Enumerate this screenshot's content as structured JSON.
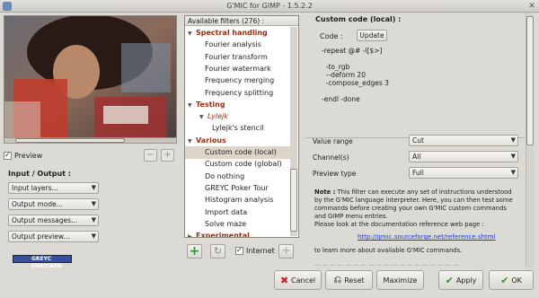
{
  "window": {
    "title": "G'MIC for GIMP - 1.5.2.2",
    "close_glyph": "✕"
  },
  "preview": {
    "checkbox_label": "Preview",
    "checked": true,
    "zoom_out_glyph": "−",
    "zoom_in_glyph": "+"
  },
  "io": {
    "title": "Input / Output :",
    "combos": [
      "Input layers...",
      "Output mode...",
      "Output messages...",
      "Output preview..."
    ]
  },
  "filters": {
    "header": "Available filters (276) :",
    "rows": [
      {
        "label": "Spectral handling",
        "type": "category",
        "expanded": true
      },
      {
        "label": "Fourier analysis",
        "type": "item"
      },
      {
        "label": "Fourier transform",
        "type": "item"
      },
      {
        "label": "Fourier watermark",
        "type": "item"
      },
      {
        "label": "Frequency merging",
        "type": "item"
      },
      {
        "label": "Frequency splitting",
        "type": "item"
      },
      {
        "label": "Testing",
        "type": "category",
        "expanded": true
      },
      {
        "label": "Lylejk",
        "type": "subcategory",
        "expanded": true
      },
      {
        "label": "Lylejk's stencil",
        "type": "subitem"
      },
      {
        "label": "Various",
        "type": "category",
        "expanded": true
      },
      {
        "label": "Custom code (local)",
        "type": "item",
        "selected": true
      },
      {
        "label": "Custom code (global)",
        "type": "item"
      },
      {
        "label": "Do nothing",
        "type": "item"
      },
      {
        "label": "GREYC Poker Tour",
        "type": "item"
      },
      {
        "label": "Histogram analysis",
        "type": "item"
      },
      {
        "label": "Import data",
        "type": "item"
      },
      {
        "label": "Solve maze",
        "type": "item"
      },
      {
        "label": "Experimental",
        "type": "category",
        "expanded": false
      }
    ],
    "internet_label": "Internet",
    "internet_checked": true
  },
  "panel": {
    "filter_title": "Custom code (local) :",
    "code_label": "Code :",
    "update_label": "Update",
    "code_text": "-repeat @# -l[$>]\n\n  -to_rgb\n  --deform 20\n  -compose_edges 3\n\n-endl -done",
    "params": [
      {
        "label": "Value range",
        "value": "Cut"
      },
      {
        "label": "Channel(s)",
        "value": "All"
      },
      {
        "label": "Preview type",
        "value": "Full"
      }
    ],
    "note_bold": "Note :",
    "note_text": " This filter can execute any set of instructions understood by the G'MIC language interpreter. Here, you can then test some commands before creating your own G'MIC custom commands and GIMP menu entries.",
    "doc_text": "Please look at the documentation reference web page :",
    "doc_link": "http://gmic.sourceforge.net/reference.shtml",
    "learn_text": "to learn more about available G'MIC commands."
  },
  "buttons": {
    "cancel": "Cancel",
    "reset": "Reset",
    "maximize": "Maximize",
    "apply": "Apply",
    "ok": "OK"
  },
  "colors": {
    "category": "#9a2d10",
    "link": "#1a3ad8",
    "selected_row": "#ddd5c8",
    "add_green": "#2a9a2a",
    "cancel_red": "#cc2222"
  }
}
